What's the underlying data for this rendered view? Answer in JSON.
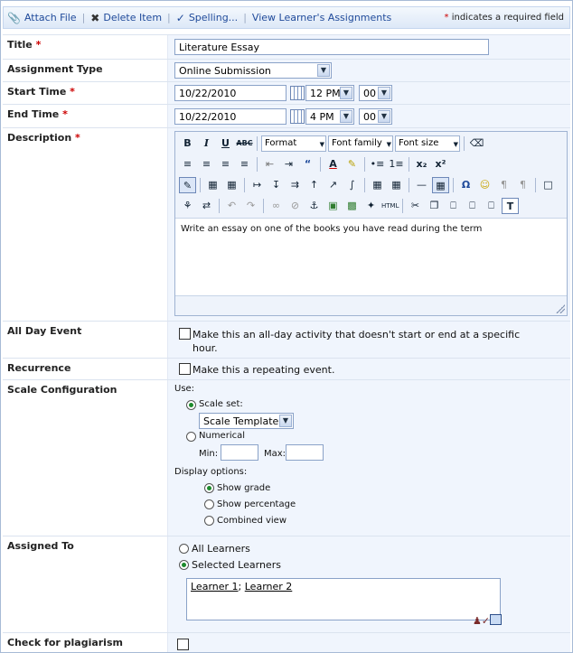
{
  "toolbar": {
    "attach_file": "Attach File",
    "delete_item": "Delete Item",
    "spelling": "Spelling...",
    "view_assignments": "View Learner's Assignments",
    "required_note": "indicates a required field"
  },
  "required_marker": "*",
  "fields": {
    "title": {
      "label": "Title",
      "value": "Literature Essay"
    },
    "assignment_type": {
      "label": "Assignment Type",
      "selected": "Online Submission"
    },
    "start_time": {
      "label": "Start Time",
      "date": "10/22/2010",
      "hour": "12 PM",
      "minute": "00"
    },
    "end_time": {
      "label": "End Time",
      "date": "10/22/2010",
      "hour": "4 PM",
      "minute": "00"
    },
    "description": {
      "label": "Description",
      "format_label": "Format",
      "font_family_label": "Font family",
      "font_size_label": "Font size",
      "text": "Write an essay on one of the books you have read during the term"
    },
    "all_day": {
      "label": "All Day Event",
      "text": "Make this an all-day activity that doesn't start or end at a specific hour.",
      "checked": false
    },
    "recurrence": {
      "label": "Recurrence",
      "text": "Make this a repeating event.",
      "checked": false
    },
    "scale": {
      "label": "Scale Configuration",
      "use_label": "Use:",
      "scale_set_label": "Scale set:",
      "template_selected": "Scale Template",
      "numerical_label": "Numerical",
      "min_label": "Min:",
      "max_label": "Max:",
      "display_label": "Display options:",
      "show_grade": "Show grade",
      "show_percentage": "Show percentage",
      "combined_view": "Combined view",
      "selected_use": "Scale set",
      "selected_display": "Show grade"
    },
    "assigned_to": {
      "label": "Assigned To",
      "all_learners": "All Learners",
      "selected_learners": "Selected Learners",
      "selected": "Selected Learners",
      "learner_1": "Learner 1",
      "separator": ";",
      "learner_2": "Learner 2"
    },
    "plagiarism": {
      "label": "Check for plagiarism",
      "checked": false
    }
  },
  "colors": {
    "link": "#1f4a9a",
    "required": "#cc0000",
    "value_bg": "#f0f5fd",
    "border": "#8aa2c8",
    "radio_selected": "#1c8a2c"
  },
  "icons": [
    "paperclip-icon",
    "delete-x-icon",
    "spellcheck-icon",
    "calendar-icon",
    "check-names-icon",
    "address-book-icon"
  ]
}
